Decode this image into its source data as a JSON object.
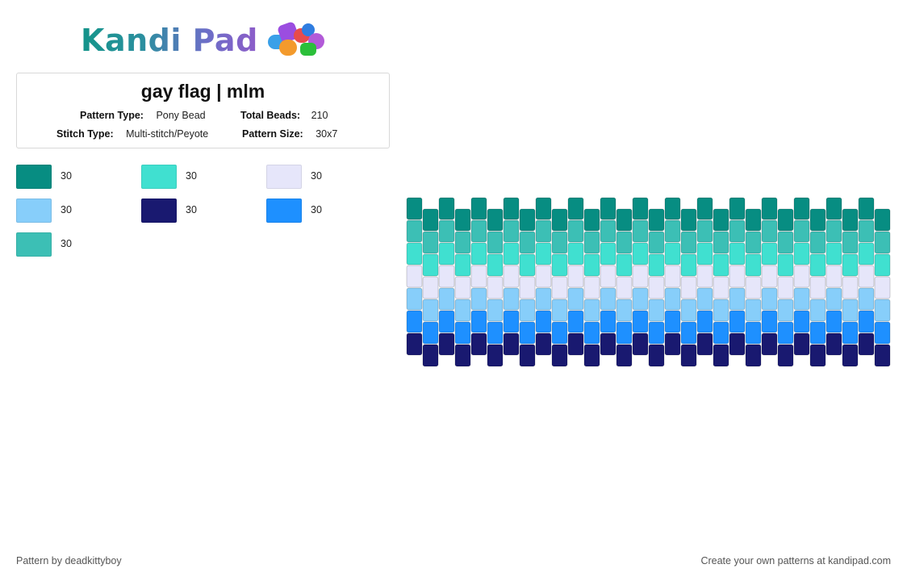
{
  "brand": {
    "name": "Kandi Pad"
  },
  "pattern": {
    "title": "gay flag | mlm",
    "type_label": "Pattern Type:",
    "type_value": "Pony Bead",
    "total_label": "Total Beads:",
    "total_value": "210",
    "stitch_label": "Stitch Type:",
    "stitch_value": "Multi-stitch/Peyote",
    "size_label": "Pattern Size:",
    "size_value": "30x7"
  },
  "colors": [
    {
      "hex": "#078d82",
      "count": "30"
    },
    {
      "hex": "#40e0d0",
      "count": "30"
    },
    {
      "hex": "#e6e6fa",
      "count": "30"
    },
    {
      "hex": "#87cefa",
      "count": "30"
    },
    {
      "hex": "#191970",
      "count": "30"
    },
    {
      "hex": "#1e90ff",
      "count": "30"
    },
    {
      "hex": "#3cbfb5",
      "count": "30"
    }
  ],
  "bead_rows": [
    "#078d82",
    "#3cbfb5",
    "#40e0d0",
    "#e6e6fa",
    "#87cefa",
    "#1e90ff",
    "#191970"
  ],
  "grid": {
    "columns": 30,
    "rows": 7
  },
  "footer": {
    "author": "Pattern by deadkittyboy",
    "cta": "Create your own patterns at kandipad.com"
  }
}
